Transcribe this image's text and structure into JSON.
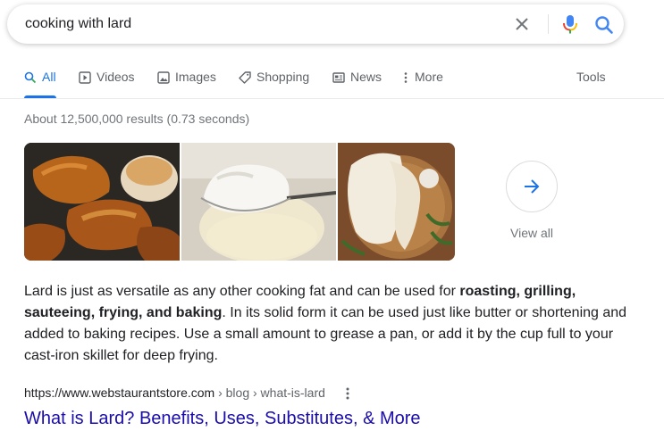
{
  "search": {
    "query": "cooking with lard"
  },
  "tabs": [
    {
      "label": "All",
      "icon": "search-icon",
      "active": true
    },
    {
      "label": "Videos",
      "icon": "video-icon"
    },
    {
      "label": "Images",
      "icon": "image-icon"
    },
    {
      "label": "Shopping",
      "icon": "tag-icon"
    },
    {
      "label": "News",
      "icon": "newspaper-icon"
    },
    {
      "label": "More",
      "icon": "more-vert-icon"
    }
  ],
  "tools_label": "Tools",
  "result_stats": "About 12,500,000 results (0.73 seconds)",
  "images": {
    "view_all_label": "View all"
  },
  "snippet": {
    "part1": "Lard is just as versatile as any other cooking fat and can be used for ",
    "bold": "roasting, grilling, sauteeing, frying, and baking",
    "part2": ". In its solid form it can be used just like butter or shortening and added to baking recipes. Use a small amount to grease a pan, or add it by the cup full to your cast-iron skillet for deep frying."
  },
  "result": {
    "domain": "https://www.webstaurantstore.com",
    "path": " › blog › what-is-lard",
    "title": "What is Lard? Benefits, Uses, Substitutes, & More"
  },
  "colors": {
    "accent": "#1a73e8",
    "link": "#1a0dab",
    "mic_blue": "#4285f4",
    "mic_red": "#ea4335",
    "mic_yellow": "#fbbc04",
    "mic_green": "#34a853"
  }
}
